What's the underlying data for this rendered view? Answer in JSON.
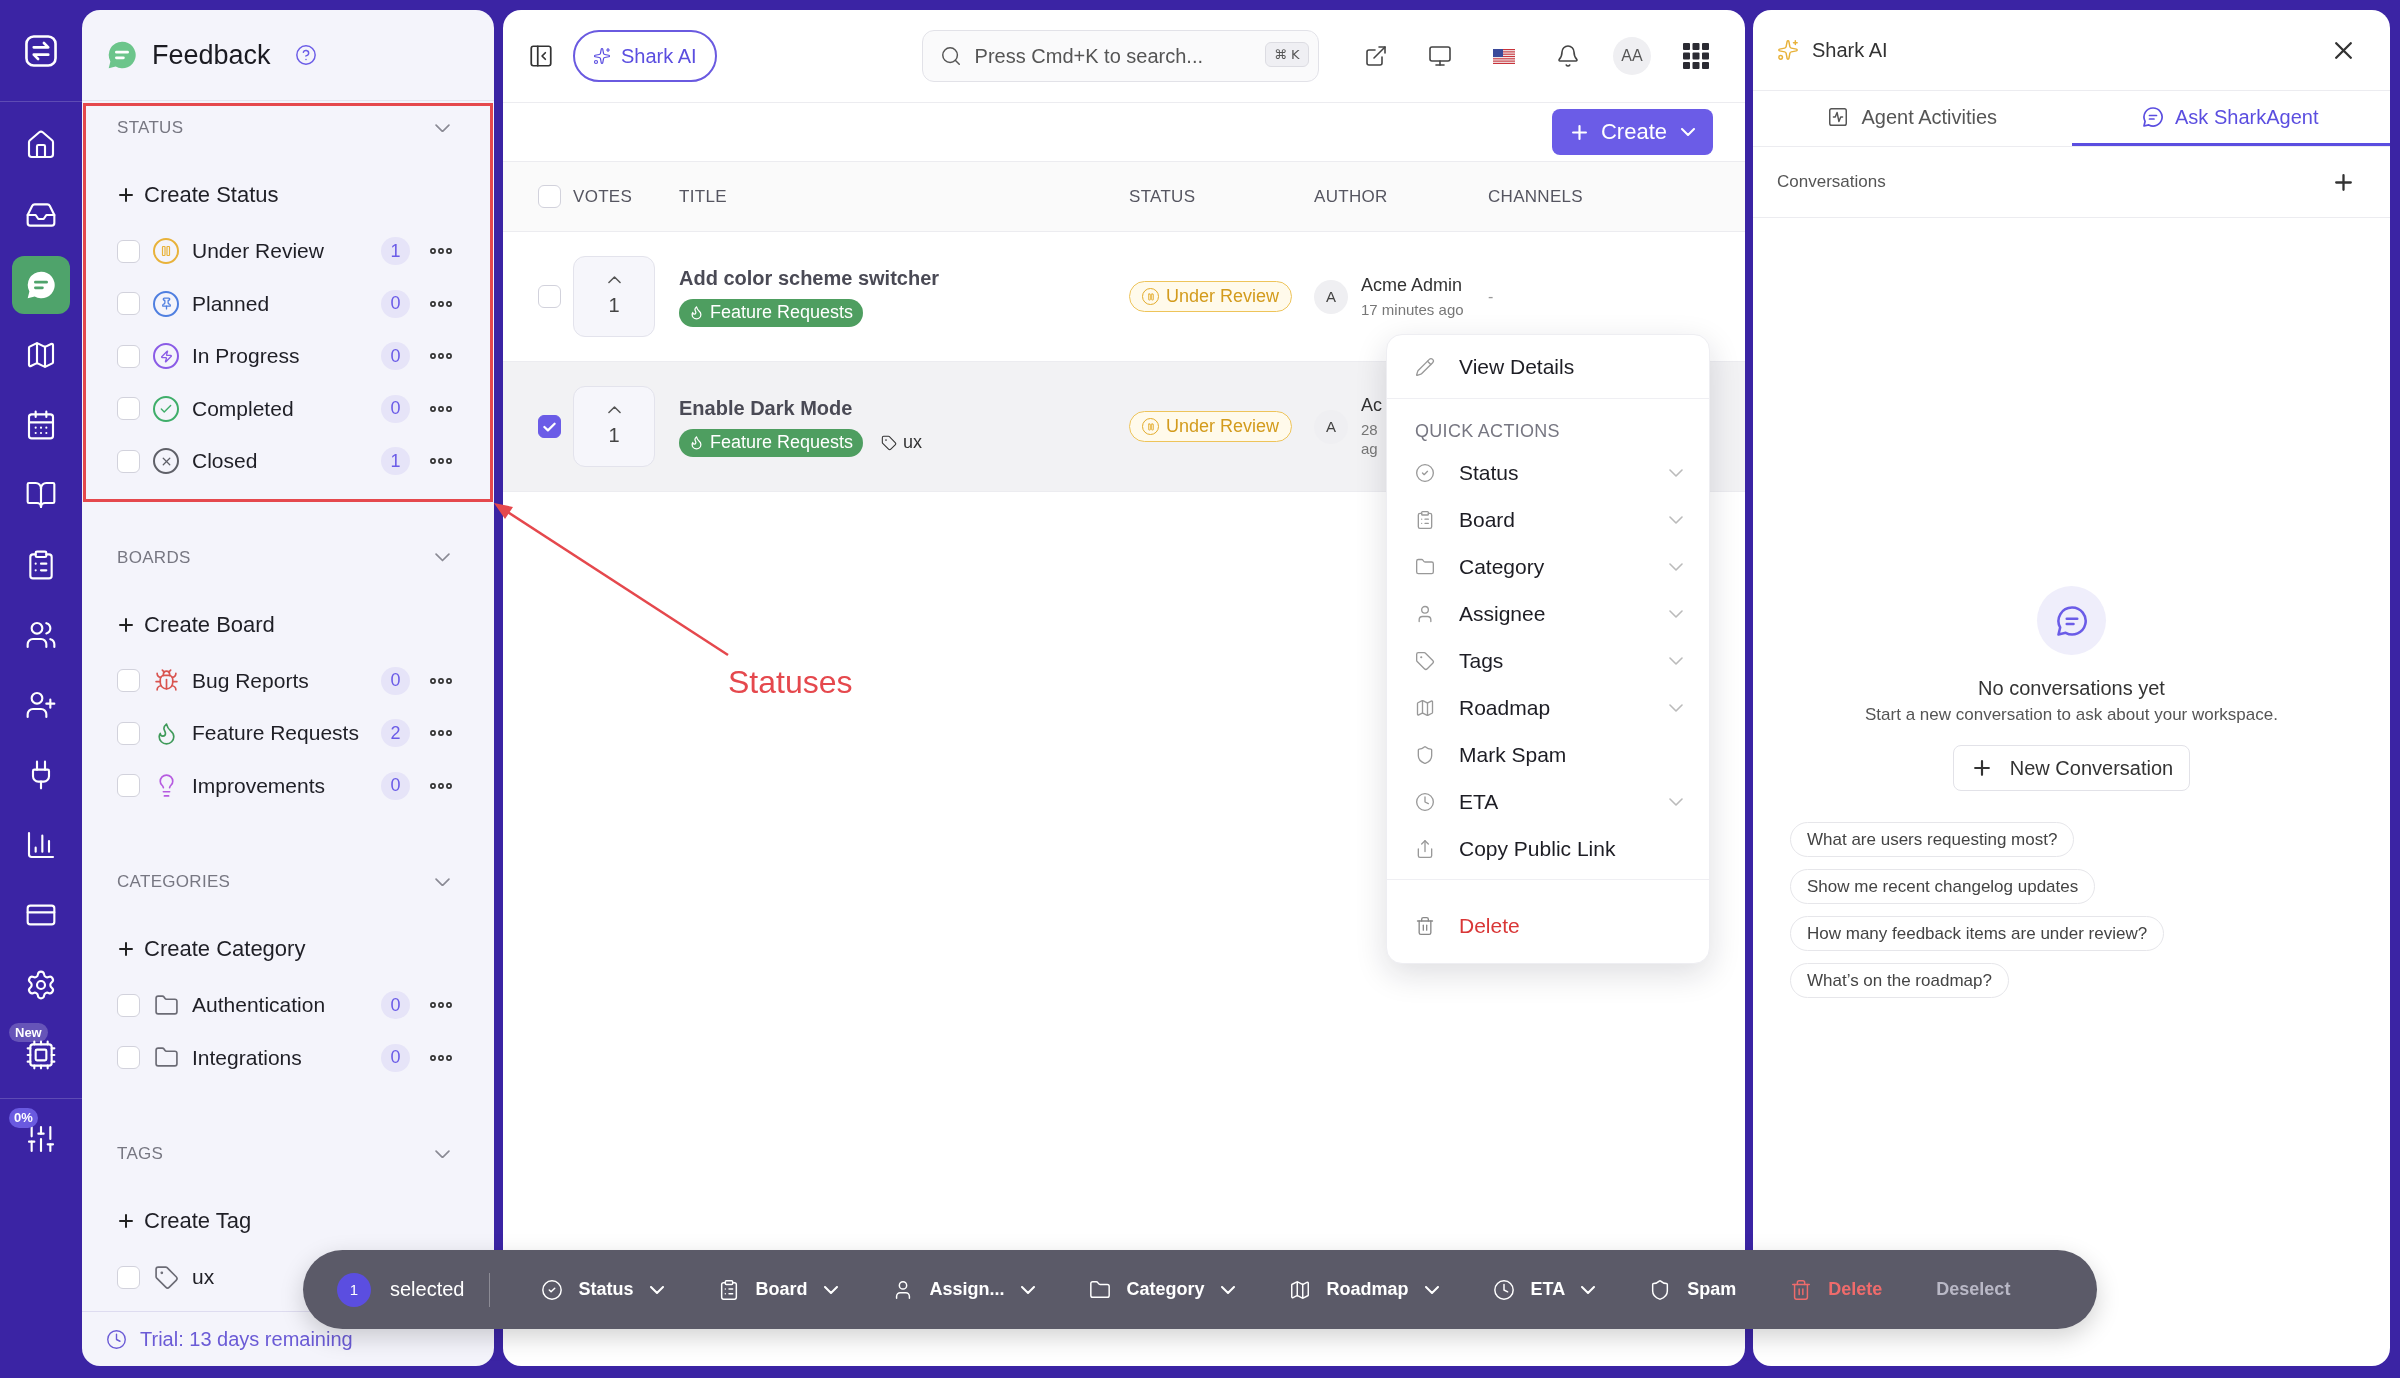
{
  "rail": {
    "items": [
      {
        "kind": "home",
        "selected": false
      },
      {
        "kind": "inbox",
        "selected": false
      },
      {
        "kind": "feedback",
        "selected": true
      },
      {
        "kind": "map",
        "selected": false
      },
      {
        "kind": "calendar",
        "selected": false
      },
      {
        "kind": "book",
        "selected": false
      },
      {
        "kind": "clipboard",
        "selected": false
      },
      {
        "kind": "users",
        "selected": false
      },
      {
        "kind": "user-add",
        "selected": false
      },
      {
        "kind": "plug",
        "selected": false
      },
      {
        "kind": "chart",
        "selected": false
      },
      {
        "kind": "card",
        "selected": false
      },
      {
        "kind": "settings",
        "selected": false
      },
      {
        "kind": "chip",
        "selected": false,
        "badge": "New"
      }
    ],
    "footer_badge": "0%"
  },
  "sidebar": {
    "title": "Feedback",
    "sections": [
      {
        "heading": "STATUS",
        "expanded": true,
        "annotated": true,
        "create": "Create Status",
        "items": [
          {
            "kind": "pause",
            "color": "#e8b23a",
            "label": "Under Review",
            "count": "1",
            "checked": false
          },
          {
            "kind": "pin",
            "color": "#4f7fe0",
            "label": "Planned",
            "count": "0",
            "checked": false
          },
          {
            "kind": "bolt",
            "color": "#8a5be6",
            "label": "In Progress",
            "count": "0",
            "checked": false
          },
          {
            "kind": "check",
            "color": "#3fae6a",
            "label": "Completed",
            "count": "0",
            "checked": false
          },
          {
            "kind": "cross",
            "color": "#5f6068",
            "label": "Closed",
            "count": "1",
            "checked": false
          }
        ]
      },
      {
        "heading": "BOARDS",
        "expanded": true,
        "annotated": false,
        "create": "Create Board",
        "items": [
          {
            "kind": "bug",
            "color": "#d9534f",
            "label": "Bug Reports",
            "count": "0",
            "checked": false
          },
          {
            "kind": "flame",
            "color": "#3f9a5a",
            "label": "Feature Requests",
            "count": "2",
            "checked": false
          },
          {
            "kind": "bulb",
            "color": "#b65be0",
            "label": "Improvements",
            "count": "0",
            "checked": false
          }
        ]
      },
      {
        "heading": "CATEGORIES",
        "expanded": true,
        "annotated": false,
        "create": "Create Category",
        "items": [
          {
            "kind": "folder",
            "label": "Authentication",
            "count": "0",
            "checked": false
          },
          {
            "kind": "folder",
            "label": "Integrations",
            "count": "0",
            "checked": false
          }
        ]
      },
      {
        "heading": "TAGS",
        "expanded": true,
        "annotated": false,
        "create": "Create Tag",
        "items": [
          {
            "kind": "tag",
            "label": "ux",
            "checked": false
          }
        ]
      }
    ],
    "trial": "Trial: 13 days remaining"
  },
  "annotation": {
    "label": "Statuses"
  },
  "header": {
    "ai_button": "Shark AI",
    "search": {
      "placeholder": "Press Cmd+K to search...",
      "shortcut": "⌘ K"
    },
    "avatar": "AA"
  },
  "create_button": "Create",
  "table": {
    "all_checked": false,
    "columns": [
      "VOTES",
      "TITLE",
      "STATUS",
      "AUTHOR",
      "CHANNELS"
    ],
    "rows": [
      {
        "checked": false,
        "votes": "1",
        "title": "Add color scheme switcher",
        "board": "Feature Requests",
        "status": "Under Review",
        "author_initial": "A",
        "author": "Acme Admin",
        "time": [
          "17 minutes ago"
        ],
        "channels": "-"
      },
      {
        "checked": true,
        "votes": "1",
        "title": "Enable Dark Mode",
        "board": "Feature Requests",
        "tags": [
          "ux"
        ],
        "status": "Under Review",
        "author_initial": "A",
        "author": "Ac",
        "time": [
          "28",
          "ag"
        ]
      }
    ]
  },
  "context_menu": {
    "view_details": "View Details",
    "heading": "QUICK ACTIONS",
    "items": [
      {
        "kind": "status",
        "label": "Status",
        "submenu": true
      },
      {
        "kind": "board",
        "label": "Board",
        "submenu": true
      },
      {
        "kind": "category",
        "label": "Category",
        "submenu": true
      },
      {
        "kind": "assignee",
        "label": "Assignee",
        "submenu": true
      },
      {
        "kind": "tags",
        "label": "Tags",
        "submenu": true
      },
      {
        "kind": "roadmap",
        "label": "Roadmap",
        "submenu": true
      },
      {
        "kind": "spam",
        "label": "Mark Spam",
        "submenu": false
      },
      {
        "kind": "eta",
        "label": "ETA",
        "submenu": true
      },
      {
        "kind": "link",
        "label": "Copy Public Link",
        "submenu": false
      }
    ],
    "delete": "Delete"
  },
  "assistant": {
    "title": "Shark AI",
    "tabs": [
      {
        "label": "Agent Activities",
        "selected": false
      },
      {
        "label": "Ask SharkAgent",
        "selected": true
      }
    ],
    "conversations_label": "Conversations",
    "empty": {
      "title": "No conversations yet",
      "text": "Start a new conversation to ask about your workspace.",
      "button": "New Conversation"
    },
    "suggestions": [
      "What are users requesting most?",
      "Show me recent changelog updates",
      "How many feedback items are under review?",
      "What’s on the roadmap?"
    ]
  },
  "bulk_bar": {
    "count": "1",
    "label": "selected",
    "actions": [
      {
        "kind": "status",
        "label": "Status",
        "submenu": true
      },
      {
        "kind": "board",
        "label": "Board",
        "submenu": true
      },
      {
        "kind": "assignee",
        "label": "Assign...",
        "submenu": true
      },
      {
        "kind": "category",
        "label": "Category",
        "submenu": true
      },
      {
        "kind": "roadmap",
        "label": "Roadmap",
        "submenu": true
      },
      {
        "kind": "eta",
        "label": "ETA",
        "submenu": true
      },
      {
        "kind": "spam",
        "label": "Spam",
        "submenu": false
      },
      {
        "kind": "delete",
        "label": "Delete",
        "submenu": false
      }
    ],
    "deselect": "Deselect"
  }
}
